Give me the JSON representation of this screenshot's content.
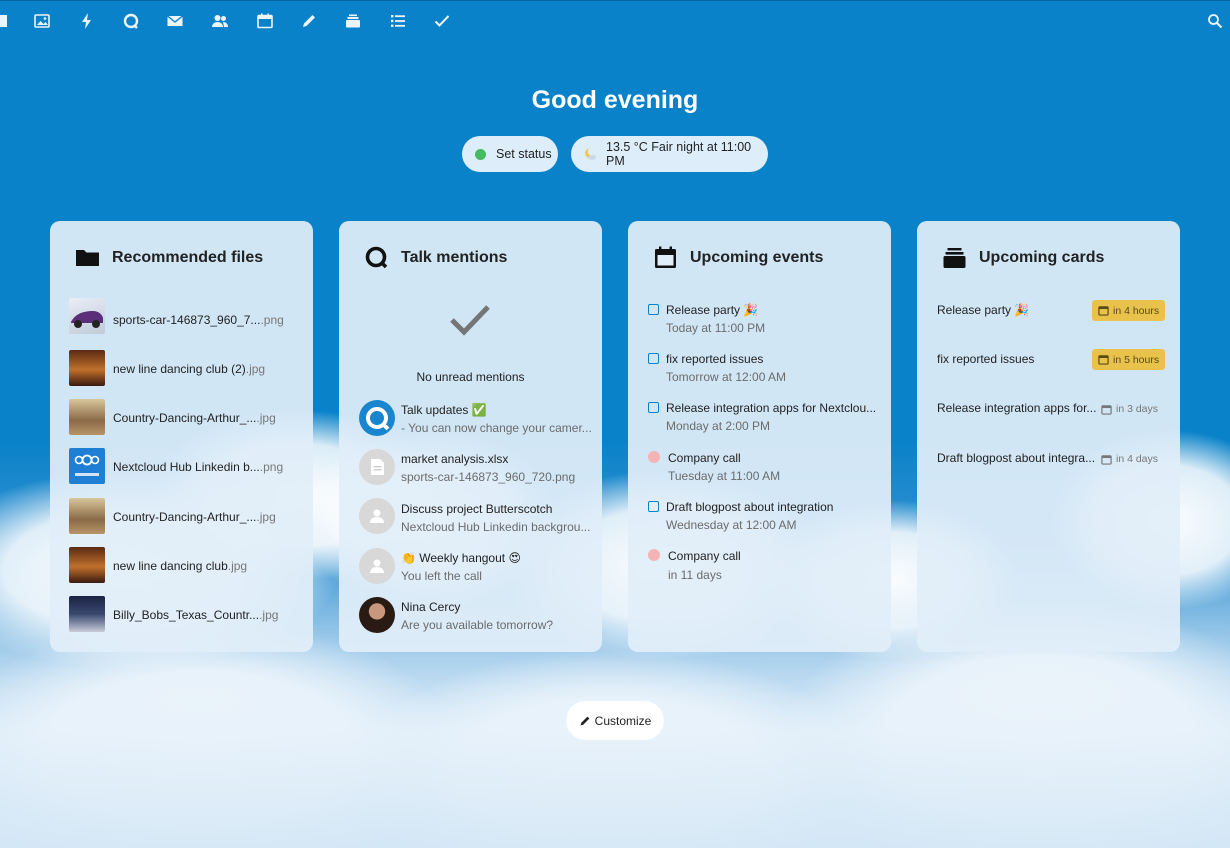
{
  "greeting": "Good evening",
  "status": {
    "set_status_label": "Set status",
    "dot_color": "#46ba61"
  },
  "weather": {
    "label": "13.5 °C Fair night at 11:00 PM"
  },
  "customize": {
    "label": "Customize"
  },
  "top_nav": {
    "icons": [
      "dashboard-icon",
      "photos-icon",
      "activity-icon",
      "talk-icon",
      "mail-icon",
      "contacts-icon",
      "calendar-icon",
      "notes-icon",
      "deck-icon",
      "tasks-icon",
      "checkmark-icon"
    ],
    "search_icon": "search-icon"
  },
  "recommended_files": {
    "title": "Recommended files",
    "items": [
      {
        "name": "sports-car-146873_960_7...",
        "ext": ".png"
      },
      {
        "name": "new line dancing club (2)",
        "ext": ".jpg"
      },
      {
        "name": "Country-Dancing-Arthur_...",
        "ext": ".jpg"
      },
      {
        "name": "Nextcloud Hub Linkedin b...",
        "ext": ".png"
      },
      {
        "name": "Country-Dancing-Arthur_...",
        "ext": ".jpg"
      },
      {
        "name": "new line dancing club",
        "ext": ".jpg"
      },
      {
        "name": "Billy_Bobs_Texas_Countr...",
        "ext": ".jpg"
      }
    ]
  },
  "talk_mentions": {
    "title": "Talk mentions",
    "empty_text": "No unread mentions",
    "items": [
      {
        "title": "Talk updates ✅",
        "subtitle": "- You can now change your camer..."
      },
      {
        "title": "market analysis.xlsx",
        "subtitle": "sports-car-146873_960_720.png"
      },
      {
        "title": "Discuss project Butterscotch",
        "subtitle": "Nextcloud Hub Linkedin backgrou..."
      },
      {
        "title": "👏 Weekly hangout 😍",
        "subtitle": "You left the call"
      },
      {
        "title": "Nina Cercy",
        "subtitle": "Are you available tomorrow?"
      }
    ]
  },
  "upcoming_events": {
    "title": "Upcoming events",
    "items": [
      {
        "title": "Release party 🎉",
        "time": "Today at 11:00 PM",
        "kind": "task"
      },
      {
        "title": "fix reported issues",
        "time": "Tomorrow at 12:00 AM",
        "kind": "task"
      },
      {
        "title": "Release integration apps for Nextclou...",
        "time": "Monday at 2:00 PM",
        "kind": "task"
      },
      {
        "title": "Company call",
        "time": "Tuesday at 11:00 AM",
        "kind": "event"
      },
      {
        "title": "Draft blogpost about integration",
        "time": "Wednesday at 12:00 AM",
        "kind": "task"
      },
      {
        "title": "Company call",
        "time": "in 11 days",
        "kind": "event"
      }
    ]
  },
  "upcoming_cards": {
    "title": "Upcoming cards",
    "items": [
      {
        "title": "Release party 🎉",
        "due": "in 4 hours",
        "highlight": true
      },
      {
        "title": "fix reported issues",
        "due": "in 5 hours",
        "highlight": true
      },
      {
        "title": "Release integration apps for...",
        "due": "in 3 days",
        "highlight": false
      },
      {
        "title": "Draft blogpost about integra...",
        "due": "in 4 days",
        "highlight": false
      }
    ]
  },
  "colors": {
    "background": "#0a82c9",
    "badge": "#e9c24b",
    "event_dot": "#f5b3b5",
    "task_checkbox": "#0a82c9"
  }
}
